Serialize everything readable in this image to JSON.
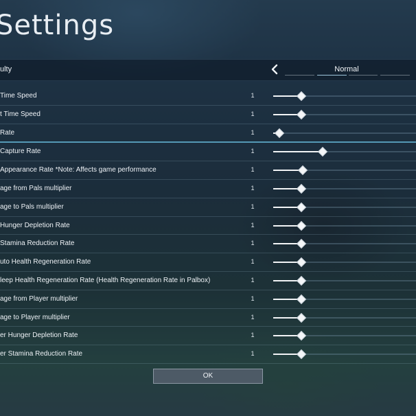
{
  "page": {
    "title": "Settings"
  },
  "difficulty": {
    "label": "ulty",
    "value": "Normal"
  },
  "settings": [
    {
      "label": "Time Speed",
      "value": "1",
      "slider_level": 0.19
    },
    {
      "label": "t Time Speed",
      "value": "1",
      "slider_level": 0.19
    },
    {
      "label": "Rate",
      "value": "1",
      "slider_level": 0.04
    },
    {
      "label": "Capture Rate",
      "value": "1",
      "slider_level": 0.34
    },
    {
      "label": "Appearance Rate *Note: Affects game performance",
      "value": "1",
      "slider_level": 0.2
    },
    {
      "label": "age from Pals multiplier",
      "value": "1",
      "slider_level": 0.19
    },
    {
      "label": "age to Pals multiplier",
      "value": "1",
      "slider_level": 0.19
    },
    {
      "label": "Hunger Depletion Rate",
      "value": "1",
      "slider_level": 0.19
    },
    {
      "label": "Stamina Reduction Rate",
      "value": "1",
      "slider_level": 0.19
    },
    {
      "label": "uto Health Regeneration Rate",
      "value": "1",
      "slider_level": 0.19
    },
    {
      "label": "leep Health Regeneration Rate (Health Regeneration Rate in Palbox)",
      "value": "1",
      "slider_level": 0.19
    },
    {
      "label": "age from Player multiplier",
      "value": "1",
      "slider_level": 0.19
    },
    {
      "label": "age to Player multiplier",
      "value": "1",
      "slider_level": 0.19
    },
    {
      "label": "er Hunger Depletion Rate",
      "value": "1",
      "slider_level": 0.19
    },
    {
      "label": "er Stamina Reduction Rate",
      "value": "1",
      "slider_level": 0.19
    }
  ],
  "footer": {
    "ok_label": "OK"
  },
  "colors": {
    "accent": "#6ec8eb",
    "slider_fill": "#f2f4f6",
    "overlay": "#121e2c"
  },
  "icons": {
    "prev": "chevron-left-icon",
    "thumb": "diamond-thumb-icon"
  }
}
